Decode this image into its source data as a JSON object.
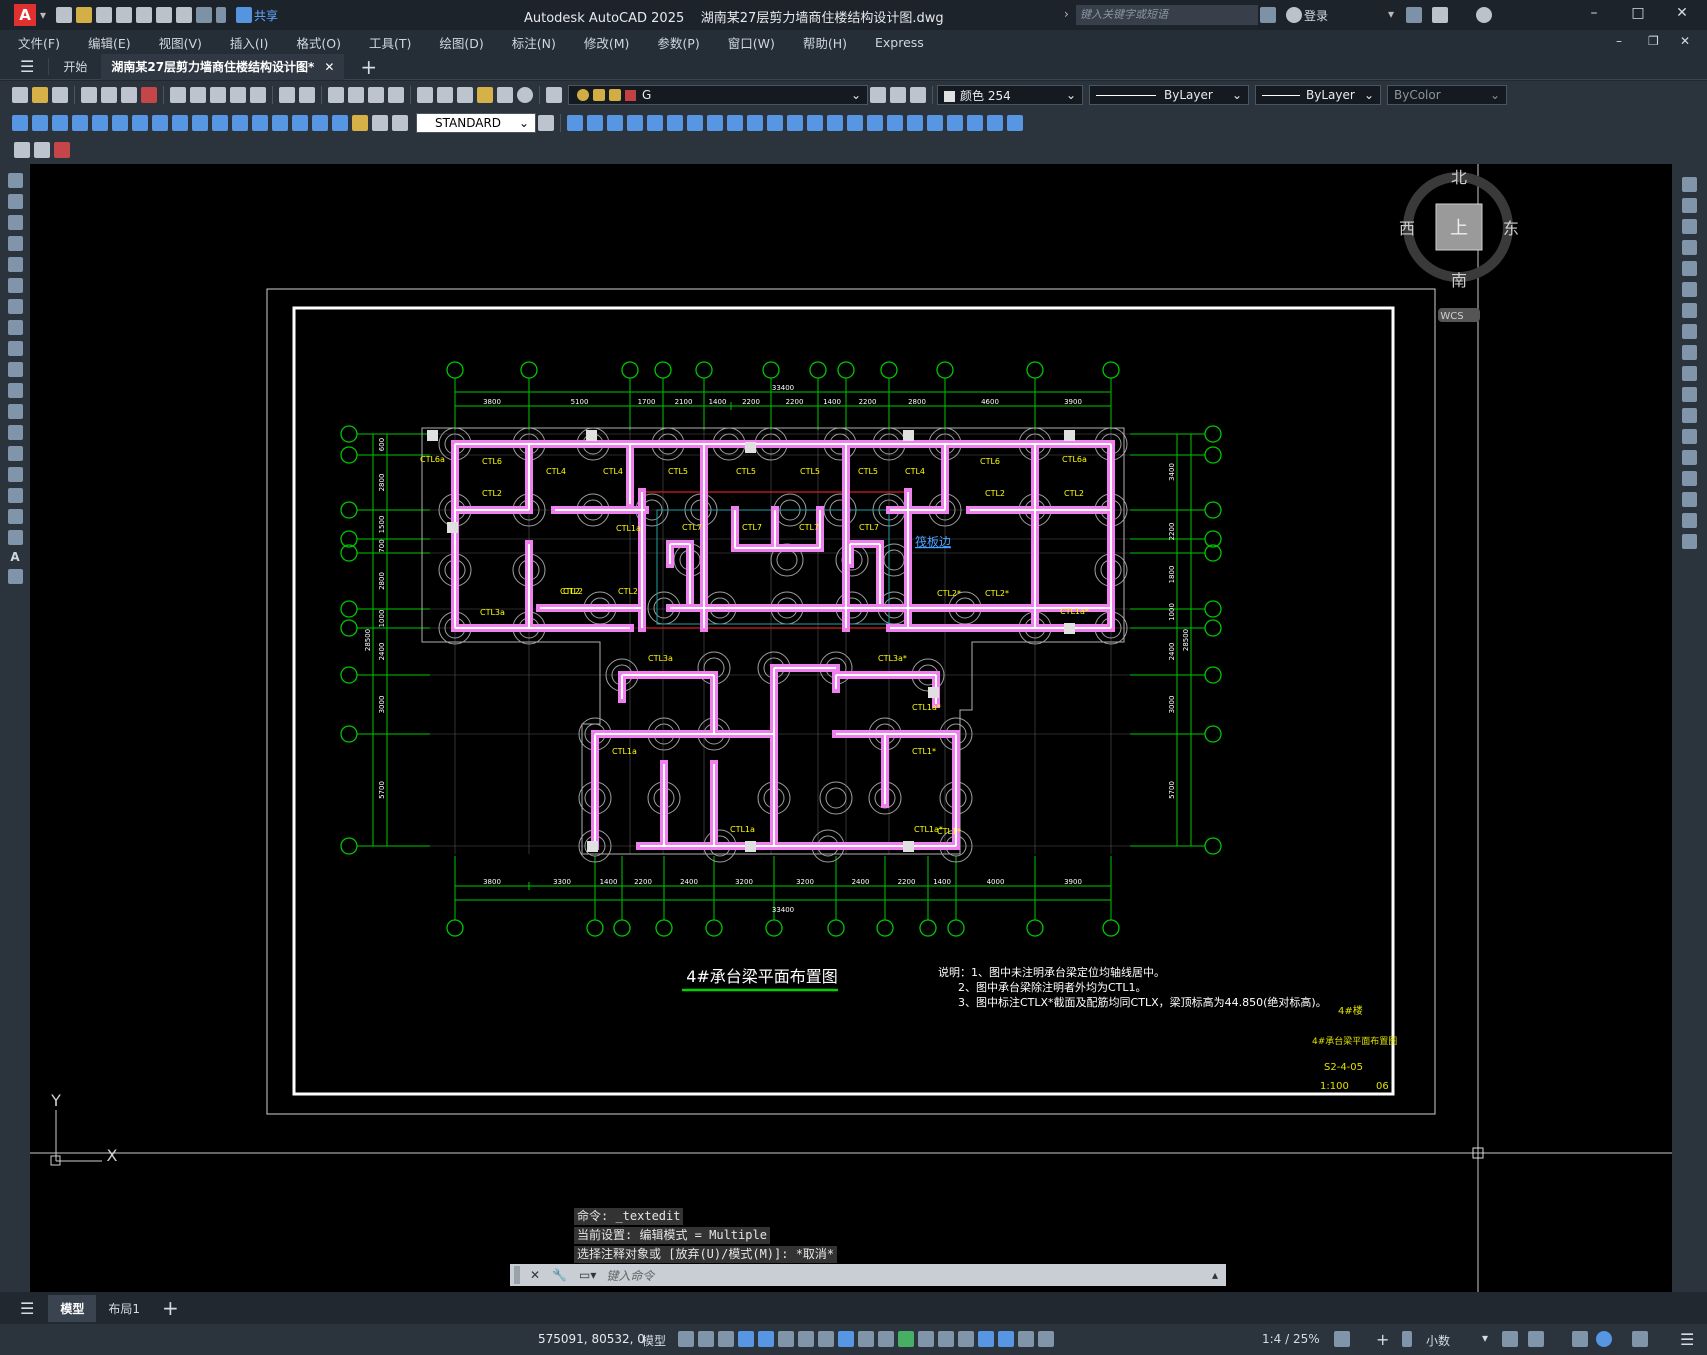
{
  "titlebar": {
    "app_logo": "A",
    "share_label": "共享",
    "title": "Autodesk AutoCAD 2025    湖南某27层剪力墙商住楼结构设计图.dwg",
    "search_placeholder": "键入关键字或短语",
    "login_label": "登录"
  },
  "menu": [
    "文件(F)",
    "编辑(E)",
    "视图(V)",
    "插入(I)",
    "格式(O)",
    "工具(T)",
    "绘图(D)",
    "标注(N)",
    "修改(M)",
    "参数(P)",
    "窗口(W)",
    "帮助(H)",
    "Express"
  ],
  "tabs": {
    "start": "开始",
    "active": "湖南某27层剪力墙商住楼结构设计图*"
  },
  "toolbar": {
    "layer": "G",
    "color": "颜色 254",
    "linetype": "ByLayer",
    "lineweight": "ByLayer",
    "plotstyle": "ByColor",
    "textstyle": "STANDARD"
  },
  "viewcube": {
    "north": "北",
    "south": "南",
    "east": "东",
    "west": "西",
    "top": "上",
    "wcs": "WCS"
  },
  "drawing": {
    "title": "4#承台梁平面布置图",
    "notes": [
      "说明：1、图中未注明承台梁定位均轴线居中。",
      "2、图中承台梁除注明者外均为CTL1。",
      "3、图中标注CTLX*截面及配筋均同CTLX，梁顶标高为44.850(绝对标高)。"
    ],
    "raft_label": "筏板边",
    "dim_top": [
      "3800",
      "5100",
      "1700",
      "2100",
      "1400",
      "2200",
      "2200",
      "1400",
      "2200",
      "2800",
      "4600",
      "3900"
    ],
    "dim_bottom": [
      "3800",
      "3300",
      "1400",
      "2200",
      "2400",
      "3200",
      "3200",
      "2400",
      "2200",
      "1400",
      "4000",
      "3900"
    ],
    "dim_total": "33400",
    "dim_left": [
      "600",
      "2800",
      "1500",
      "700",
      "2800",
      "1000"
    ],
    "dim_right": [
      "3400",
      "2200",
      "1800",
      "1000"
    ],
    "dim_side_total": "28500",
    "dim_low": [
      "2400",
      "3000",
      "5700"
    ],
    "beam_labels": [
      "CTL6a",
      "CTL6",
      "CTL4",
      "CTL4",
      "CTL5",
      "CTL5",
      "CTL5",
      "CTL5",
      "CTL4",
      "CTL6",
      "CTL6a",
      "CTL2",
      "CTL2",
      "CTL2",
      "CTL2",
      "CTL1a",
      "CTL7",
      "CTL7",
      "CTL7",
      "CTL7",
      "CTL2",
      "CTL2",
      "CTL2*",
      "CTL2*",
      "CTL3a",
      "CTL1a*",
      "CTL3a",
      "CTL3a*",
      "CTL1a*",
      "CTL1a",
      "CTL1*",
      "CTL1*",
      "CTL1a",
      "CTL1a*"
    ],
    "titleblock": [
      "4#楼",
      "4#承台梁平面布置图",
      "S2-4-05",
      "1:100",
      "06"
    ]
  },
  "command": {
    "history": [
      "命令: _textedit",
      "当前设置: 编辑模式 = Multiple",
      "选择注释对象或 [放弃(U)/模式(M)]: *取消*"
    ],
    "placeholder": "键入命令"
  },
  "layouts": {
    "model": "模型",
    "layout1": "布局1"
  },
  "status": {
    "coords": "575091, 80532, 0",
    "mode": "模型",
    "scale": "1:4 / 25%",
    "units": "小数"
  },
  "colors": {
    "canvas": "#000000",
    "beam": "#f080f0",
    "axis": "#00c800",
    "label": "#ffff00"
  }
}
